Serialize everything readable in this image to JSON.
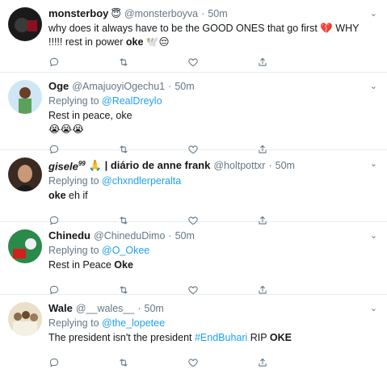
{
  "tweets": [
    {
      "name": "monsterboy",
      "badge": "😇",
      "handle": "@monsterboyva",
      "time": "50m",
      "reply_to": "",
      "text_pre": "why does it always have to be the GOOD ONES that go first 💔 WHY !!!!! rest in power ",
      "text_bold": "oke",
      "text_post": " 🕊️😔",
      "avatar_color": "#1a1a1a"
    },
    {
      "name": "Oge",
      "handle": "@AmajuoyiOgechu1",
      "time": "50m",
      "reply_prefix": "Replying to ",
      "reply_to": "@RealDreylo",
      "line1": "Rest in peace, oke",
      "line2": "😭😭😭",
      "avatar_color": "#cfe7f5"
    },
    {
      "name": "gisele",
      "name_sup": "99",
      "name_suffix": "🙏 | diário de anne frank",
      "handle": "@holtpottxr",
      "time": "50m",
      "reply_prefix": "Replying to ",
      "reply_to": "@chxndlerperalta",
      "text_bold": "oke",
      "text_post": " eh if",
      "avatar_color": "#3a2a22"
    },
    {
      "name": "Chinedu",
      "handle": "@ChineduDimo",
      "time": "50m",
      "reply_prefix": "Replying to ",
      "reply_to": "@O_Okee",
      "text_pre": "Rest in Peace ",
      "text_bold": "Oke",
      "avatar_color": "#2a8a4a"
    },
    {
      "name": "Wale",
      "handle": "@__wales__",
      "time": "50m",
      "reply_prefix": "Replying to ",
      "reply_to": "@the_lopetee",
      "text_pre": "The president isn't the president ",
      "hashtag": "#EndBuhari",
      "text_post": " RIP ",
      "text_bold": "OKE",
      "avatar_color": "#e8e0c8"
    }
  ],
  "sep": "·",
  "colors": {
    "accent": "#1da1f2",
    "muted": "#657786",
    "text": "#14171a",
    "border": "#e6ecf0"
  },
  "icons": [
    "reply-icon",
    "retweet-icon",
    "like-icon",
    "share-icon",
    "chevron-down-icon"
  ]
}
